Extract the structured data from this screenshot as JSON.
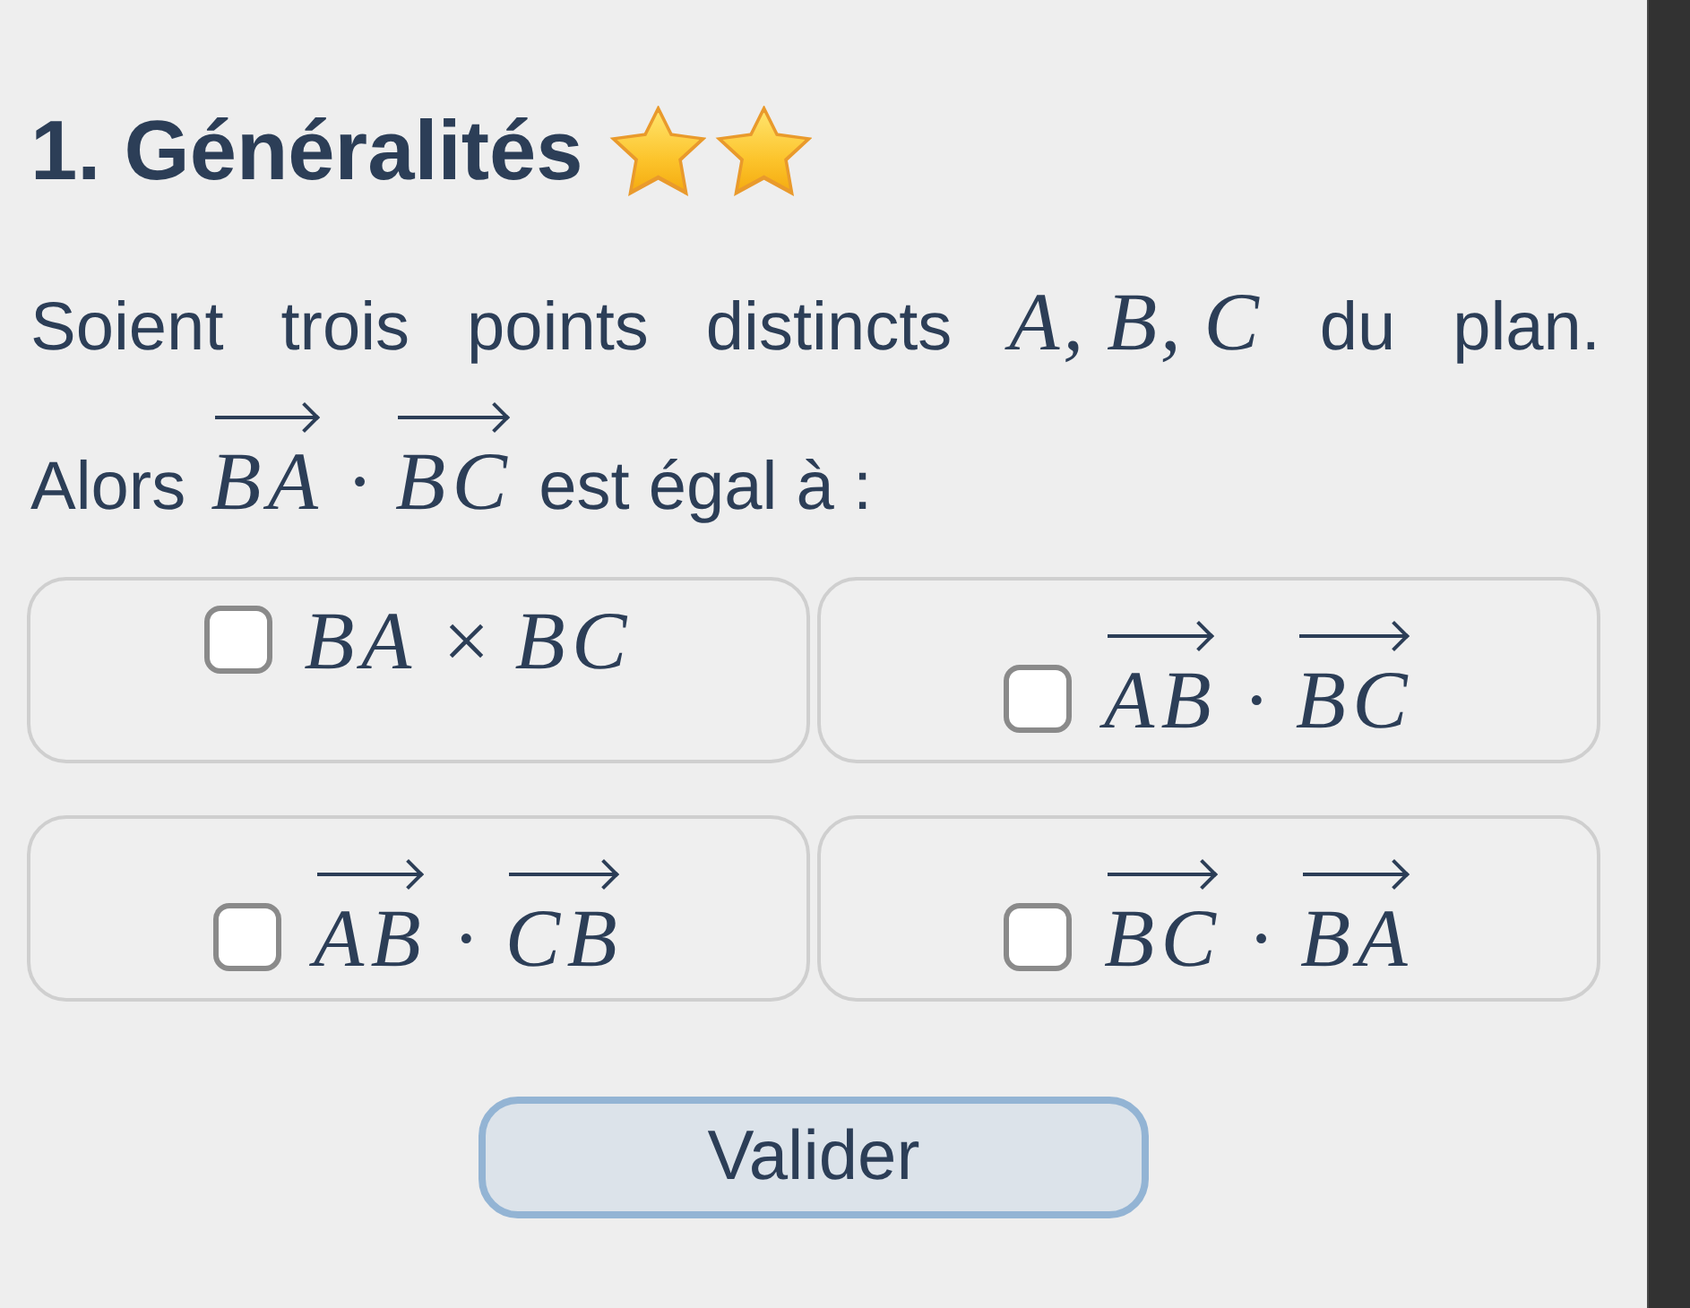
{
  "heading": {
    "title": "1. Généralités"
  },
  "question": {
    "statement": "Soient trois points distincts *A, B, C* du plan.",
    "prompt": [
      {
        "kind": "text",
        "text": "Alors"
      },
      {
        "kind": "vector",
        "text": "BA"
      },
      {
        "kind": "operator",
        "text": "·"
      },
      {
        "kind": "vector",
        "text": "BC"
      },
      {
        "kind": "text",
        "text": "est égal à :"
      }
    ]
  },
  "options": [
    {
      "checked": false,
      "parts": [
        {
          "kind": "variable",
          "text": "BA"
        },
        {
          "kind": "operator",
          "text": "×"
        },
        {
          "kind": "variable",
          "text": "BC"
        }
      ]
    },
    {
      "checked": false,
      "parts": [
        {
          "kind": "vector",
          "text": "AB"
        },
        {
          "kind": "operator",
          "text": "·"
        },
        {
          "kind": "vector",
          "text": "BC"
        }
      ]
    },
    {
      "checked": false,
      "parts": [
        {
          "kind": "vector",
          "text": "AB"
        },
        {
          "kind": "operator",
          "text": "·"
        },
        {
          "kind": "vector",
          "text": "CB"
        }
      ]
    },
    {
      "checked": false,
      "parts": [
        {
          "kind": "vector",
          "text": "BC"
        },
        {
          "kind": "operator",
          "text": "·"
        },
        {
          "kind": "vector",
          "text": "BA"
        }
      ]
    }
  ],
  "submit_button": {
    "label": "Valider"
  }
}
